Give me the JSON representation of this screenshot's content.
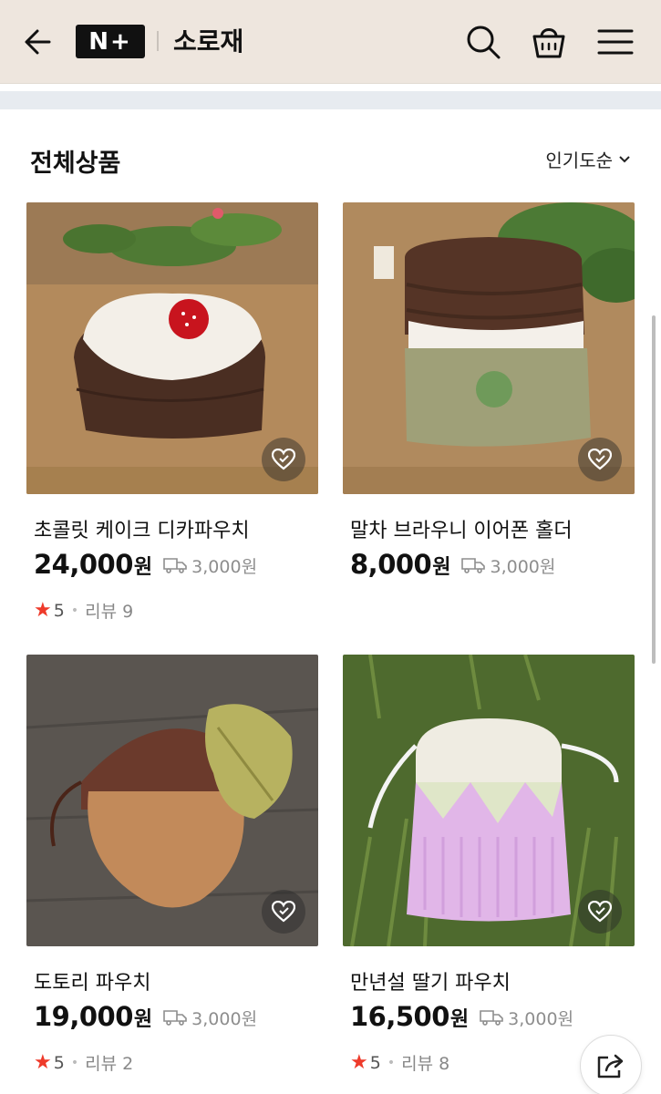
{
  "header": {
    "logo_text": "N+",
    "store_name": "소로재",
    "icons": [
      "back-arrow-icon",
      "search-icon",
      "shopping-bag-icon",
      "menu-icon"
    ],
    "background": "#eee6de"
  },
  "section": {
    "title": "전체상품",
    "sort_label": "인기도순"
  },
  "products": [
    {
      "name": "초콜릿 케이크 디카파우치",
      "price": "24,000",
      "currency": "원",
      "shipping": "3,000원",
      "rating": "5",
      "review_label": "리뷰 9"
    },
    {
      "name": "말차 브라우니 이어폰 홀더",
      "price": "8,000",
      "currency": "원",
      "shipping": "3,000원"
    },
    {
      "name": "도토리 파우치",
      "price": "19,000",
      "currency": "원",
      "shipping": "3,000원",
      "rating": "5",
      "review_label": "리뷰 2"
    },
    {
      "name": "만년설 딸기 파우치",
      "price": "16,500",
      "currency": "원",
      "shipping": "3,000원",
      "rating": "5",
      "review_label": "리뷰 8"
    }
  ],
  "colors": {
    "star": "#ee3a2a",
    "divider": "#e7ebf0"
  }
}
